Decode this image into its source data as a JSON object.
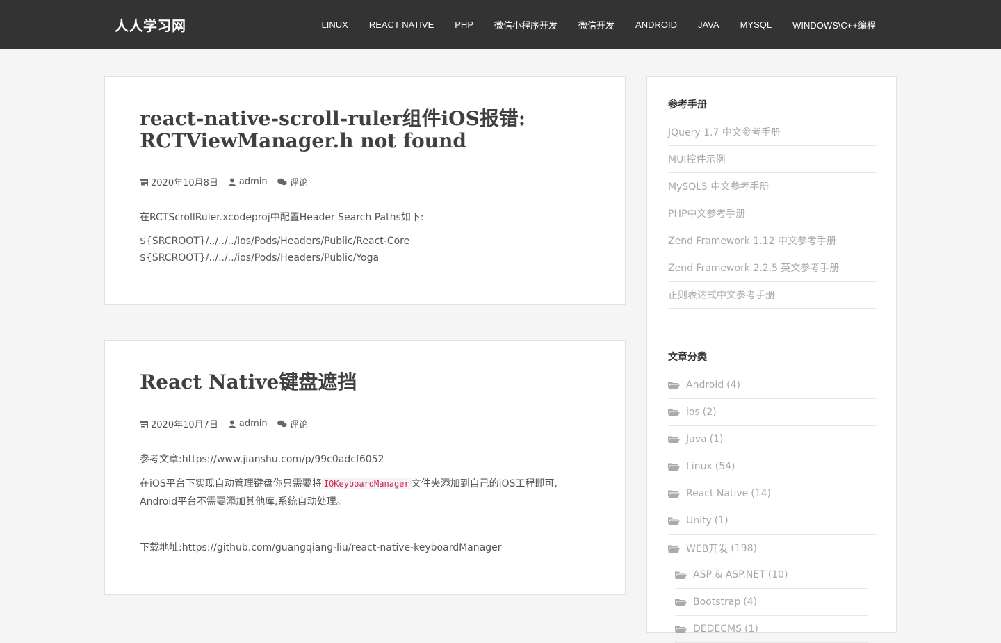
{
  "site": {
    "brand": "人人学习网"
  },
  "nav": {
    "items": [
      "LINUX",
      "REACT NATIVE",
      "PHP",
      "微信小程序开发",
      "微信开发",
      "ANDROID",
      "JAVA",
      "MYSQL",
      "WINDOWS\\C++编程"
    ]
  },
  "posts": [
    {
      "title_line1": "react-native-scroll-ruler组件iOS报错:",
      "title_line2": "RCTViewManager.h not found",
      "date": "2020年10月8日",
      "author": "admin",
      "comments": "评论",
      "p1": "在RCTScrollRuler.xcodeproj中配置Header Search Paths如下:",
      "p2": "${SRCROOT}/../../../ios/Pods/Headers/Public/React-Core",
      "p3": "${SRCROOT}/../../../ios/Pods/Headers/Public/Yoga"
    },
    {
      "title": "React Native键盘遮挡",
      "date": "2020年10月7日",
      "author": "admin",
      "comments": "评论",
      "p1": "参考文章:https://www.jianshu.com/p/99c0adcf6052",
      "p2_before": "在iOS平台下实现自动管理键盘你只需要将",
      "p2_code": "IQKeyboardManager",
      "p2_after": "文件夹添加到自己的iOS工程即可,",
      "p2_line2": "Android平台不需要添加其他库,系统自动处理。",
      "p3": "下载地址:https://github.com/guangqiang-liu/react-native-keyboardManager"
    }
  ],
  "sidebar": {
    "manuals_title": "参考手册",
    "manuals": [
      "JQuery 1.7 中文参考手册",
      "MUI控件示例",
      "MySQL5 中文参考手册",
      "PHP中文参考手册",
      "Zend Framework 1.12 中文参考手册",
      "Zend Framework 2.2.5 英文参考手册",
      "正则表达式中文参考手册"
    ],
    "categories_title": "文章分类",
    "categories": [
      {
        "name": "Android",
        "count": "(4)"
      },
      {
        "name": "ios",
        "count": "(2)"
      },
      {
        "name": "Java",
        "count": "(1)"
      },
      {
        "name": "Linux",
        "count": "(54)"
      },
      {
        "name": "React Native",
        "count": "(14)"
      },
      {
        "name": "Unity",
        "count": "(1)"
      },
      {
        "name": "WEB开发",
        "count": "(198)"
      }
    ],
    "subcategories": [
      {
        "name": "ASP & ASP.NET",
        "count": "(10)"
      },
      {
        "name": "Bootstrap",
        "count": "(4)"
      },
      {
        "name": "DEDECMS",
        "count": "(1)"
      }
    ]
  },
  "colors": {
    "navbar": "#333333",
    "link": "#a8a8a8",
    "title": "#404040",
    "code": "#c7254e"
  }
}
